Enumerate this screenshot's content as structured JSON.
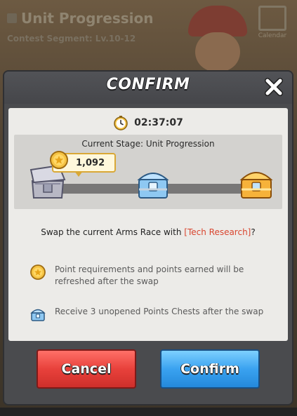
{
  "background": {
    "title": "Unit Progression",
    "subtitle": "Contest Segment: Lv.10-12",
    "calendar_label": "Calendar"
  },
  "dialog": {
    "title": "CONFIRM",
    "timer": "02:37:07",
    "stage_title": "Current Stage: Unit Progression",
    "points": "1,092",
    "progress_fraction": 0.08,
    "question_prefix": "Swap the current Arms Race with ",
    "question_highlight": "[Tech Research]",
    "question_suffix": "?",
    "info": [
      {
        "icon": "gold-coin-icon",
        "text": "Point requirements and points earned will be refreshed after the swap"
      },
      {
        "icon": "points-chest-icon",
        "text": "Receive 3 unopened Points Chests after the swap"
      }
    ],
    "cancel_label": "Cancel",
    "confirm_label": "Confirm",
    "colors": {
      "highlight": "#d9462f",
      "cancel": "#e8413b",
      "confirm": "#3aa2f0"
    }
  }
}
